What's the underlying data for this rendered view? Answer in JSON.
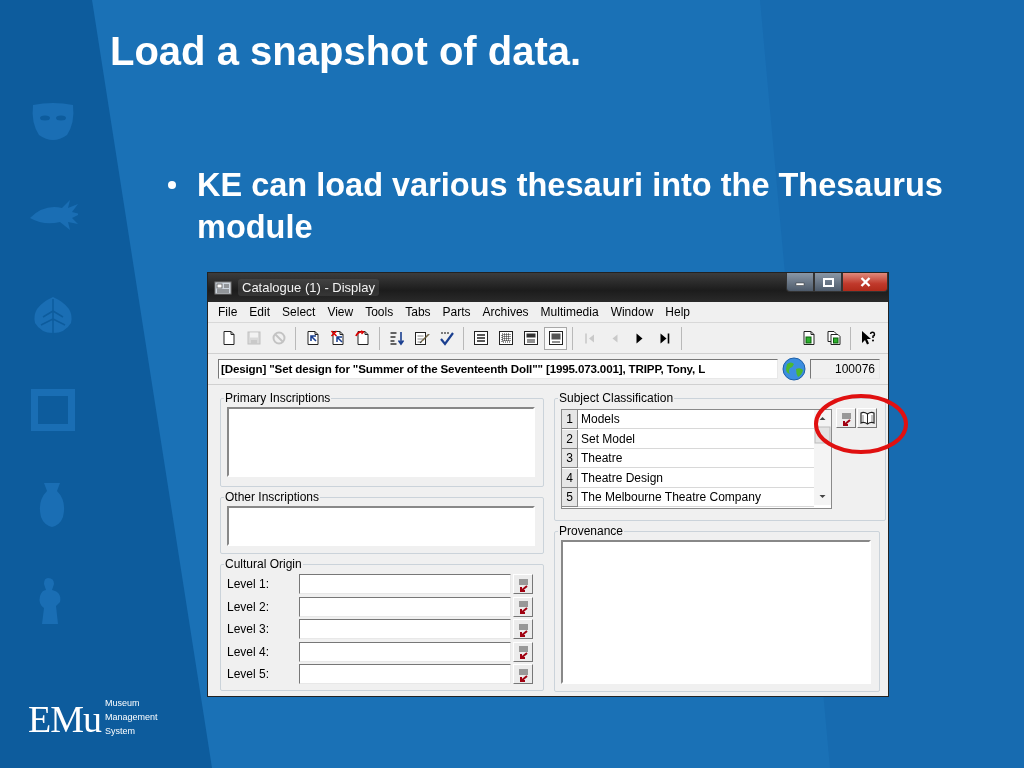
{
  "slide": {
    "title": "Load a snapshot of data.",
    "bullets": [
      "KE can load various thesauri into the Thesaurus module"
    ],
    "logo": {
      "wordmark": "EMu",
      "tagline": [
        "Museum",
        "Management",
        "System"
      ]
    }
  },
  "window": {
    "title": "Catalogue (1) - Display"
  },
  "menu": [
    {
      "label": "File"
    },
    {
      "label": "Edit"
    },
    {
      "label": "Select"
    },
    {
      "label": "View"
    },
    {
      "label": "Tools"
    },
    {
      "label": "Tabs"
    },
    {
      "label": "Parts"
    },
    {
      "label": "Archives"
    },
    {
      "label": "Multimedia"
    },
    {
      "label": "Window"
    },
    {
      "label": "Help"
    }
  ],
  "toolbar": {
    "left": [
      [
        {
          "kind": "new",
          "disabled": false
        },
        {
          "kind": "save",
          "disabled": true
        },
        {
          "kind": "cancel",
          "disabled": true
        }
      ],
      [
        {
          "kind": "open",
          "disabled": false
        },
        {
          "kind": "remove",
          "disabled": false
        },
        {
          "kind": "discard",
          "disabled": false
        }
      ],
      [
        {
          "kind": "sort",
          "disabled": false
        },
        {
          "kind": "edit",
          "disabled": false
        },
        {
          "kind": "spell",
          "disabled": false
        }
      ],
      [
        {
          "kind": "details",
          "selected": false
        },
        {
          "kind": "grid",
          "selected": false
        },
        {
          "kind": "form",
          "selected": false
        },
        {
          "kind": "image",
          "selected": true
        }
      ],
      [
        {
          "kind": "first",
          "disabled": true
        },
        {
          "kind": "prev",
          "disabled": true
        },
        {
          "kind": "next",
          "disabled": false
        },
        {
          "kind": "last",
          "disabled": false
        }
      ]
    ],
    "right": [
      [
        {
          "kind": "copy",
          "disabled": false
        },
        {
          "kind": "paste",
          "disabled": false
        }
      ],
      [
        {
          "kind": "help",
          "disabled": false
        }
      ]
    ]
  },
  "record": {
    "summary": "[Design] \"Set design for \"Summer of the Seventeenth Doll\"\" [1995.073.001], TRIPP, Tony, L",
    "irn": "100076"
  },
  "primary_inscriptions": {
    "label": "Primary Inscriptions"
  },
  "other_inscriptions": {
    "label": "Other Inscriptions"
  },
  "cultural_origin": {
    "label": "Cultural Origin",
    "levels": [
      {
        "label": "Level 1:"
      },
      {
        "label": "Level 2:"
      },
      {
        "label": "Level 3:"
      },
      {
        "label": "Level 4:"
      },
      {
        "label": "Level 5:"
      }
    ]
  },
  "subject_classification": {
    "label": "Subject Classification",
    "rows": [
      {
        "number": "1",
        "term": "Models"
      },
      {
        "number": "2",
        "term": "Set Model"
      },
      {
        "number": "3",
        "term": "Theatre"
      },
      {
        "number": "4",
        "term": "Theatre Design"
      },
      {
        "number": "5",
        "term": "The Melbourne Theatre Company"
      }
    ]
  },
  "provenance": {
    "label": "Provenance"
  }
}
